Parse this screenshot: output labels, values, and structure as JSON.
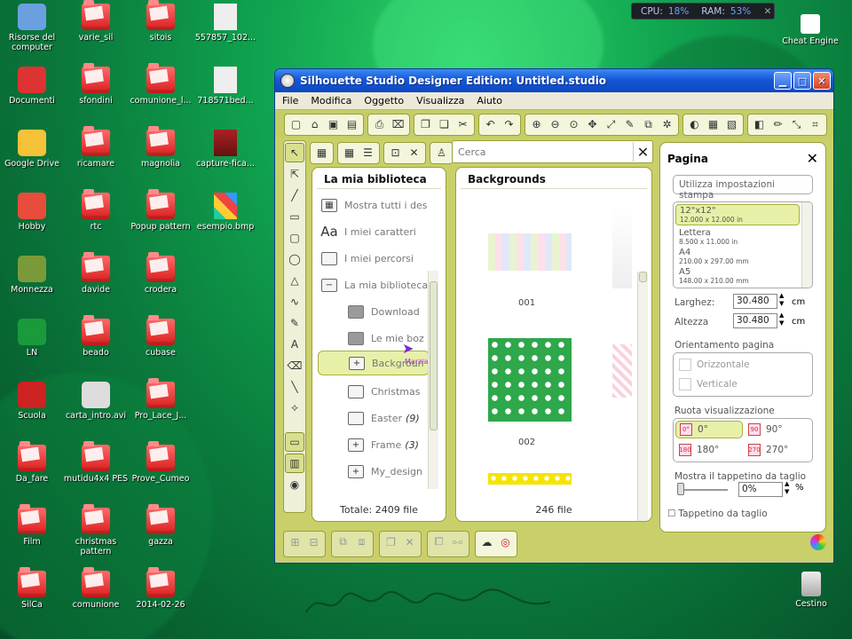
{
  "meter": {
    "cpu_label": "CPU:",
    "cpu": "18%",
    "ram_label": "RAM:",
    "ram": "53%"
  },
  "desktop": {
    "icons": [
      {
        "label": "Risorse del computer"
      },
      {
        "label": "varie_sil"
      },
      {
        "label": "sitois"
      },
      {
        "label": "557857_102..."
      },
      {
        "label": "Documenti"
      },
      {
        "label": "sfondini"
      },
      {
        "label": "comunione_l..."
      },
      {
        "label": "718571bed..."
      },
      {
        "label": "Google Drive"
      },
      {
        "label": "ricamare"
      },
      {
        "label": "magnolia"
      },
      {
        "label": "capture-fica..."
      },
      {
        "label": "Hobby"
      },
      {
        "label": "rtc"
      },
      {
        "label": "Popup pattern"
      },
      {
        "label": "esempio.bmp"
      },
      {
        "label": "Monnezza"
      },
      {
        "label": "davide"
      },
      {
        "label": "crodera"
      },
      {
        "label": "LN"
      },
      {
        "label": "beado"
      },
      {
        "label": "cubase"
      },
      {
        "label": "Scuola"
      },
      {
        "label": "carta_intro.avi"
      },
      {
        "label": "Pro_Lace_J..."
      },
      {
        "label": "Da_fare"
      },
      {
        "label": "mutidu4x4 PES"
      },
      {
        "label": "Prove_Cumeo"
      },
      {
        "label": "Film"
      },
      {
        "label": "christmas pattern"
      },
      {
        "label": "gazza"
      },
      {
        "label": "SilCa"
      },
      {
        "label": "comunione"
      },
      {
        "label": "2014-02-26"
      }
    ],
    "cheat_engine": "Cheat Engine",
    "cestino": "Cestino"
  },
  "window": {
    "title": "Silhouette Studio Designer Edition: Untitled.studio",
    "menu": [
      "File",
      "Modifica",
      "Oggetto",
      "Visualizza",
      "Aiuto"
    ],
    "search_placeholder": "Cerca"
  },
  "library": {
    "title": "La mia biblioteca",
    "tree": [
      {
        "label": "Mostra tutti i des",
        "count": ""
      },
      {
        "label": "I miei caratteri",
        "count": ""
      },
      {
        "label": "I miei percorsi",
        "count": ""
      },
      {
        "label": "La mia biblioteca",
        "count": ""
      },
      {
        "label": "Download",
        "count": ""
      },
      {
        "label": "Le mie boz",
        "count": ""
      },
      {
        "label": "Backgroun",
        "count": ""
      },
      {
        "label": "Christmas",
        "count": ""
      },
      {
        "label": "Easter",
        "count": "(9)"
      },
      {
        "label": "Frame",
        "count": "(3)"
      },
      {
        "label": "My_design",
        "count": ""
      }
    ],
    "cursor_label": "Marzia",
    "total": "Totale: 2409 file"
  },
  "backgrounds": {
    "title": "Backgrounds",
    "items": [
      {
        "label": "001"
      },
      {
        "label": "002"
      }
    ],
    "count": "246 file"
  },
  "page_panel": {
    "title": "Pagina",
    "use_settings": "Utilizza impostazioni stampa",
    "sizes": [
      {
        "name": "12\"x12\"",
        "dims": "12.000 x 12.000 in"
      },
      {
        "name": "Lettera",
        "dims": "8.500 x 11.000 in"
      },
      {
        "name": "A4",
        "dims": "210.00 x 297.00 mm"
      },
      {
        "name": "A5",
        "dims": "148.00 x 210.00 mm"
      }
    ],
    "width_label": "Larghez:",
    "width_value": "30.480",
    "width_unit": "cm",
    "height_label": "Altezza",
    "height_value": "30.480",
    "height_unit": "cm",
    "orientation_label": "Orientamento pagina",
    "orientation": [
      "Orizzontale",
      "Verticale"
    ],
    "rotation_label": "Ruota visualizzazione",
    "rotations": [
      "0°",
      "90°",
      "180°",
      "270°"
    ],
    "mat_label": "Mostra il tappetino da taglio",
    "mat_value": "0%",
    "mat_unit": "%",
    "mat_check": "Tappetino da taglio"
  }
}
